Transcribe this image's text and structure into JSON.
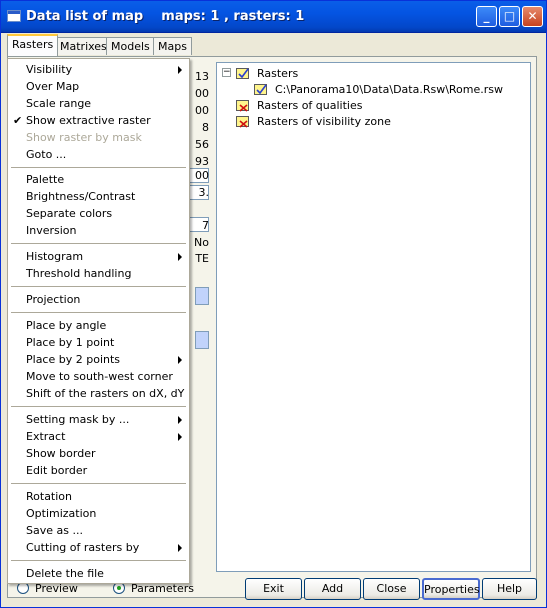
{
  "window": {
    "title": "Data list of map    maps: 1 , rasters: 1",
    "minimize": "_",
    "maximize": "□",
    "close": "✕"
  },
  "tabs": [
    "Rasters",
    "Matrixes",
    "Models",
    "Maps"
  ],
  "peek_values": [
    "13",
    "00",
    "00",
    "8",
    "56",
    "93",
    "00",
    "3.",
    "7",
    "No",
    "TE"
  ],
  "tree": {
    "root": "Rasters",
    "file": "C:\\Panorama10\\Data\\Data.Rsw\\Rome.rsw",
    "qualities": "Rasters of qualities",
    "visibility": "Rasters of visibility zone",
    "expander": "−"
  },
  "bottom": {
    "radio_preview": "Preview",
    "radio_parameters": "Parameters",
    "exit": "Exit",
    "add": "Add",
    "close": "Close",
    "properties": "Properties",
    "help": "Help"
  },
  "menu": {
    "items": [
      {
        "label": "Visibility",
        "submenu": true
      },
      {
        "label": "Over Map"
      },
      {
        "label": "Scale range"
      },
      {
        "label": "Show extractive raster",
        "checked": true
      },
      {
        "label": "Show raster by mask",
        "disabled": true
      },
      {
        "label": "Goto ..."
      },
      {
        "label": "Palette"
      },
      {
        "label": "Brightness/Contrast"
      },
      {
        "label": "Separate colors"
      },
      {
        "label": "Inversion"
      },
      {
        "label": "Histogram",
        "submenu": true
      },
      {
        "label": "Threshold handling"
      },
      {
        "label": "Projection"
      },
      {
        "label": "Place by angle"
      },
      {
        "label": "Place by 1 point"
      },
      {
        "label": "Place by 2 points",
        "submenu": true
      },
      {
        "label": "Move to south-west corner"
      },
      {
        "label": "Shift of the rasters on dX, dY"
      },
      {
        "label": "Setting mask by ...",
        "submenu": true
      },
      {
        "label": "Extract",
        "submenu": true
      },
      {
        "label": "Show border"
      },
      {
        "label": "Edit border"
      },
      {
        "label": "Rotation"
      },
      {
        "label": "Optimization"
      },
      {
        "label": "Save as ..."
      },
      {
        "label": "Cutting of rasters by",
        "submenu": true
      },
      {
        "label": "Delete the file"
      }
    ]
  }
}
